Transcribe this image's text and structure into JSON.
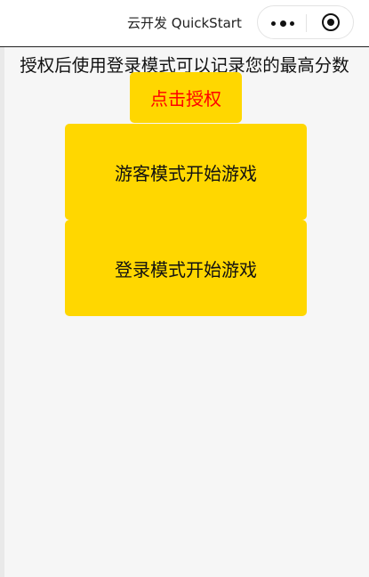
{
  "navbar": {
    "title": "云开发 QuickStart",
    "capsule": {
      "more_icon": "more-dots-icon",
      "close_icon": "target-circle-icon"
    }
  },
  "content": {
    "hint_text": "授权后使用登录模式可以记录您的最高分数",
    "auth_button_label": "点击授权",
    "guest_button_label": "游客模式开始游戏",
    "login_button_label": "登录模式开始游戏"
  },
  "colors": {
    "button_bg": "#ffd700",
    "auth_text": "#ff0000",
    "page_bg": "#f6f6f6"
  }
}
